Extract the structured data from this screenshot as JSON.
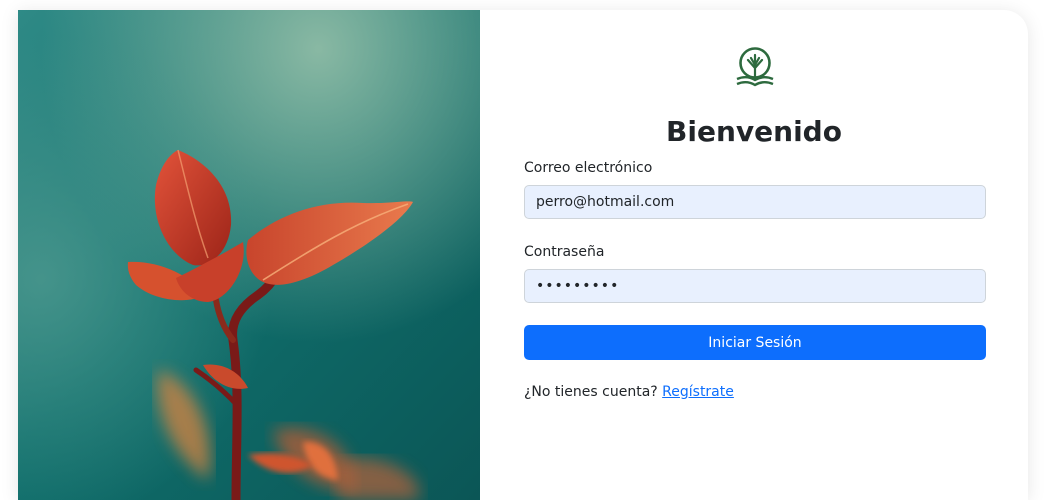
{
  "colors": {
    "primary": "#0d6efd",
    "input_background": "#e8f0fe",
    "logo": "#2d6a3e",
    "text": "#212529"
  },
  "hero_image": {
    "description_icon": "plant-photo"
  },
  "logo": {
    "icon": "tree-book-icon"
  },
  "login": {
    "title": "Bienvenido",
    "email_label": "Correo electrónico",
    "email_value": "perro@hotmail.com",
    "password_label": "Contraseña",
    "password_value": "•••••••••",
    "submit_label": "Iniciar Sesión",
    "register_prompt": "¿No tienes cuenta?",
    "register_link": "Regístrate"
  }
}
